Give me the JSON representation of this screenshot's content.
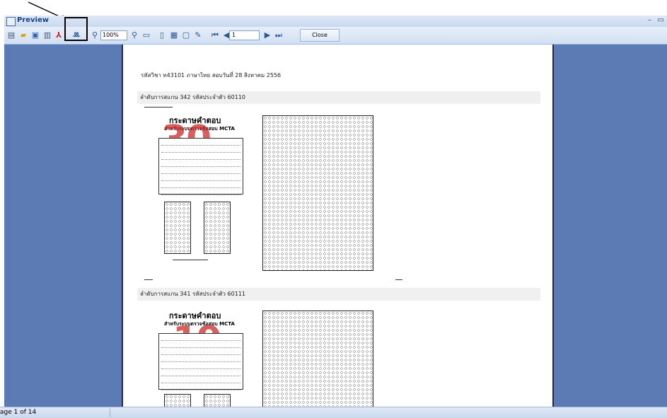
{
  "window": {
    "title": "Preview"
  },
  "toolbar": {
    "zoom_value": "100%",
    "page_value": "1",
    "close_label": "Close"
  },
  "icons": [
    "print-icon",
    "open-icon",
    "save-icon",
    "quick-print-icon",
    "pdf-icon",
    "find-icon",
    "zoom-icon",
    "zoom-out-icon",
    "one-page-icon",
    "two-page-icon",
    "multi-page-icon",
    "page-setup-icon",
    "edit-icon",
    "first-page-icon",
    "prev-page-icon",
    "next-page-icon",
    "last-page-icon"
  ],
  "document": {
    "header": "รหัสวิชา ท43101 ภาษาไทย สอบวันที่ 28 สิงหาคม 2556",
    "sections": [
      {
        "title": "ลำดับการสแกน 342  รหัสประจำตัว 60110",
        "score": "30",
        "sheet_heading": "กระดาษคำตอบ",
        "sheet_subheading": "สำหรับระบบตรวจข้อสอบ MCTA"
      },
      {
        "title": "ลำดับการสแกน 341  รหัสประจำตัว 60111",
        "score": "19",
        "sheet_heading": "กระดาษคำตอบ",
        "sheet_subheading": "สำหรับระบบตรวจข้อสอบ MCTA"
      }
    ]
  },
  "status": {
    "page_text": "age 1 of 14"
  },
  "colors": {
    "preview_bg": "#5c7bb4",
    "score_red": "#cc2828",
    "toolbar": "#d3e0f2"
  }
}
